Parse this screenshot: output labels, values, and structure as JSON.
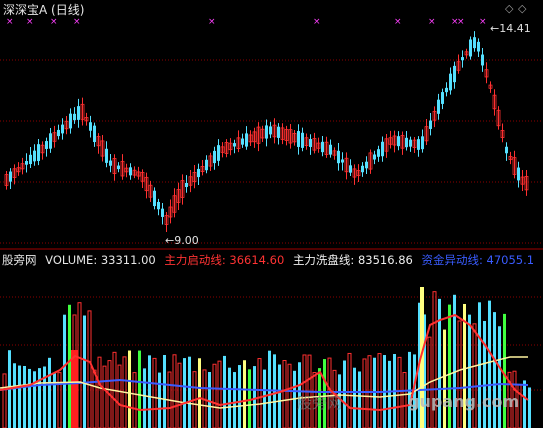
{
  "header": {
    "title": "深深宝A (日线)",
    "nav_left": "◇",
    "nav_right": "◇"
  },
  "price_panel": {
    "high_label": "14.41",
    "low_label": "9.00"
  },
  "indicator": {
    "name": "股旁网",
    "volume_label": "VOLUME: 33311.00",
    "line1_label": "主力启动线: 36614.60",
    "line2_label": "主力洗盘线: 83516.86",
    "line3_label": "资金异动线: 47055.1"
  },
  "watermark": {
    "site_cn": "股旁网",
    "site_en": "gupang.com"
  },
  "colors": {
    "background": "#000000",
    "up": "#ff3030",
    "down": "#55e0ff",
    "grid": "#8b0000",
    "line1": "#ff3030",
    "line2": "#ffffff",
    "line3": "#3a5cff",
    "marker": "#ff40ff"
  }
}
